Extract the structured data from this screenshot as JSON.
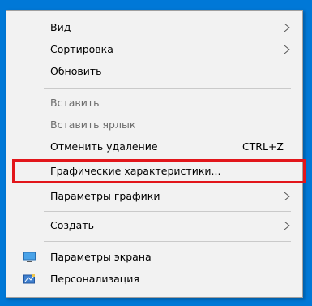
{
  "menu": {
    "items": [
      {
        "label": "Вид",
        "submenu": true
      },
      {
        "label": "Сортировка",
        "submenu": true
      },
      {
        "label": "Обновить"
      },
      {
        "label": "Вставить",
        "disabled": true
      },
      {
        "label": "Вставить ярлык",
        "disabled": true
      },
      {
        "label": "Отменить удаление",
        "shortcut": "CTRL+Z"
      },
      {
        "label": "Графические характеристики..."
      },
      {
        "label": "Параметры графики",
        "submenu": true
      },
      {
        "label": "Создать",
        "submenu": true
      },
      {
        "label": "Параметры экрана",
        "icon": "display-icon"
      },
      {
        "label": "Персонализация",
        "icon": "personalize-icon"
      }
    ]
  },
  "colors": {
    "desktop": "#0078d7",
    "highlight_border": "#e2161b",
    "menu_bg": "#f2f2f2",
    "disabled_text": "#6d6d6d"
  }
}
